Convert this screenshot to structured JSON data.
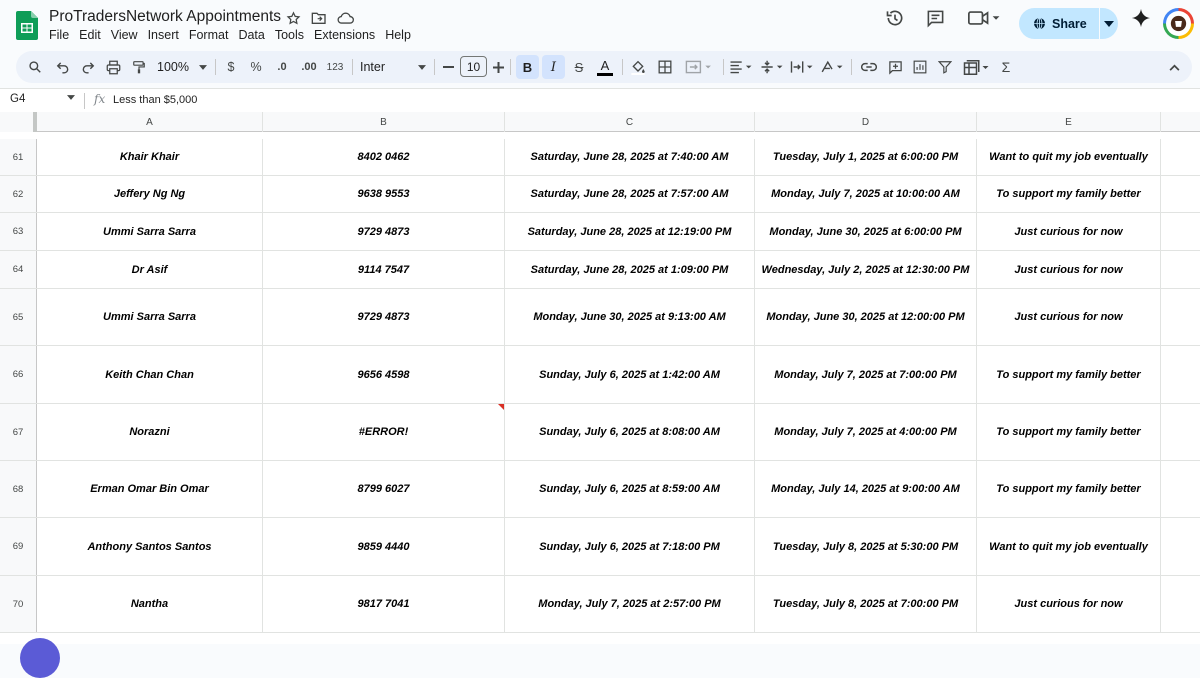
{
  "app": {
    "title": "ProTradersNetwork Appointments",
    "menu": [
      "File",
      "Edit",
      "View",
      "Insert",
      "Format",
      "Data",
      "Tools",
      "Extensions",
      "Help"
    ],
    "share_label": "Share"
  },
  "toolbar": {
    "zoom": "100%",
    "currency": "$",
    "percent": "%",
    "dec_decrease": ".0",
    "dec_increase": ".00",
    "number_format": "123",
    "font": "Inter",
    "font_size": "10",
    "bold": "B",
    "italic": "I",
    "strike": "S",
    "text_color": "A",
    "sum": "Σ"
  },
  "formula_bar": {
    "cell_ref": "G4",
    "fx": "fx",
    "value": "Less than $5,000"
  },
  "columns": [
    "A",
    "B",
    "C",
    "D",
    "E"
  ],
  "rows": [
    {
      "num": "61",
      "cells": [
        "Khair Khair",
        "8402 0462",
        "Saturday, June 28, 2025 at 7:40:00 AM",
        "Tuesday, July 1, 2025 at 6:00:00 PM",
        "Want to quit my job eventually"
      ]
    },
    {
      "num": "62",
      "cells": [
        "Jeffery Ng Ng",
        "9638 9553",
        "Saturday, June 28, 2025 at 7:57:00 AM",
        "Monday, July 7, 2025 at 10:00:00 AM",
        "To support my family better"
      ]
    },
    {
      "num": "63",
      "cells": [
        "Ummi Sarra Sarra",
        "9729 4873",
        "Saturday, June 28, 2025 at 12:19:00 PM",
        "Monday, June 30, 2025 at 6:00:00 PM",
        "Just curious for now"
      ]
    },
    {
      "num": "64",
      "cells": [
        "Dr Asif",
        "9114 7547",
        "Saturday, June 28, 2025 at 1:09:00 PM",
        "Wednesday, July 2, 2025 at 12:30:00 PM",
        "Just curious for now"
      ]
    },
    {
      "num": "65",
      "cells": [
        "Ummi Sarra Sarra",
        "9729 4873",
        "Monday, June 30, 2025 at 9:13:00 AM",
        "Monday, June 30, 2025 at 12:00:00 PM",
        "Just curious for now"
      ]
    },
    {
      "num": "66",
      "cells": [
        "Keith Chan Chan",
        "9656 4598",
        "Sunday, July 6, 2025 at 1:42:00 AM",
        "Monday, July 7, 2025 at 7:00:00 PM",
        "To support my family better"
      ]
    },
    {
      "num": "67",
      "cells": [
        "Norazni",
        "#ERROR!",
        "Sunday, July 6, 2025 at 8:08:00 AM",
        "Monday, July 7, 2025 at 4:00:00 PM",
        "To support my family better"
      ]
    },
    {
      "num": "68",
      "cells": [
        "Erman Omar Bin Omar",
        "8799 6027",
        "Sunday, July 6, 2025 at 8:59:00 AM",
        "Monday, July 14, 2025 at 9:00:00 AM",
        "To support my family better"
      ]
    },
    {
      "num": "69",
      "cells": [
        "Anthony Santos Santos",
        "9859 4440",
        "Sunday, July 6, 2025 at 7:18:00 PM",
        "Tuesday, July 8, 2025 at 5:30:00 PM",
        "Want to quit my job eventually"
      ]
    },
    {
      "num": "70",
      "cells": [
        "Nantha",
        "9817 7041",
        "Monday, July 7, 2025 at 2:57:00 PM",
        "Tuesday, July 8, 2025 at 7:00:00 PM",
        "Just curious for now"
      ]
    }
  ],
  "colors": {
    "accent": "#c2e7ff",
    "toolbar_bg": "#edf2fa",
    "active_button": "#d3e3fd",
    "error_marker": "#d93025"
  }
}
